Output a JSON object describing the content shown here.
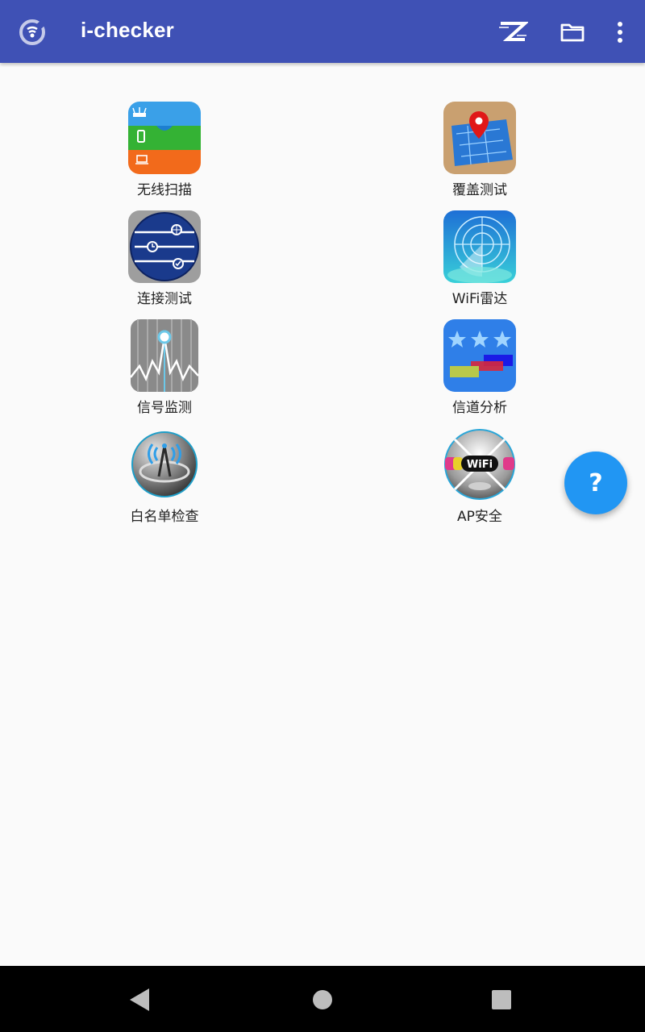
{
  "app_bar": {
    "title": "i-checker",
    "background": "#3f51b5",
    "actions": [
      "z-logo-icon",
      "folder-icon",
      "more-vert-icon"
    ]
  },
  "grid": {
    "items": [
      {
        "label": "无线扫描",
        "icon": "wireless-scan-icon"
      },
      {
        "label": "覆盖测试",
        "icon": "coverage-map-pin-icon"
      },
      {
        "label": "连接测试",
        "icon": "connection-test-icon"
      },
      {
        "label": "WiFi雷达",
        "icon": "radar-icon"
      },
      {
        "label": "信号监测",
        "icon": "signal-monitor-icon"
      },
      {
        "label": "信道分析",
        "icon": "channel-analysis-icon"
      },
      {
        "label": "白名单检查",
        "icon": "whitelist-antenna-icon"
      },
      {
        "label": "AP安全",
        "icon": "ap-security-wifi-icon"
      }
    ],
    "wifi_badge_text": "WiFi"
  },
  "fab": {
    "label": "?",
    "color": "#2196f3"
  },
  "nav_bar": {
    "buttons": [
      "back-icon",
      "home-icon",
      "recents-icon"
    ]
  }
}
